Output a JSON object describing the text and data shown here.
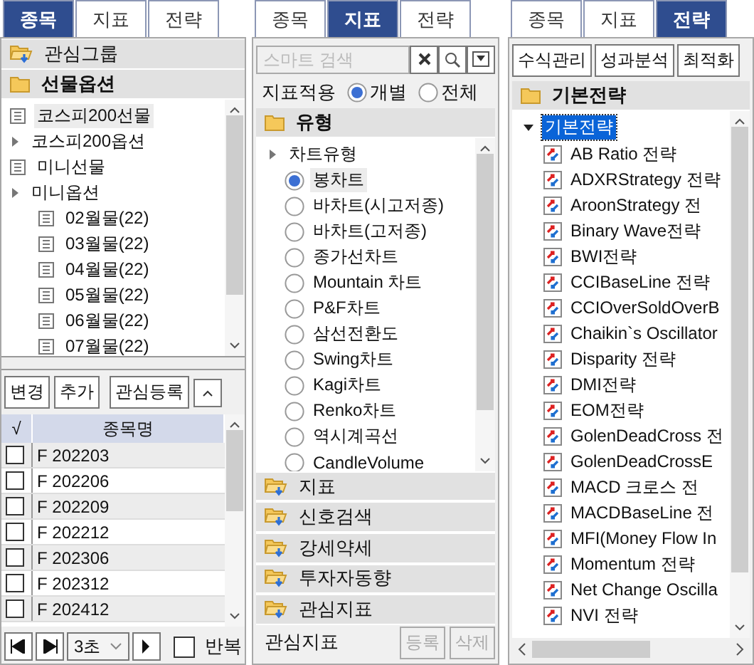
{
  "stock_panel": {
    "tabs": [
      {
        "label": "종목",
        "selected": true
      },
      {
        "label": "지표",
        "selected": false
      },
      {
        "label": "전략",
        "selected": false
      }
    ],
    "groups": [
      {
        "label": "관심그룹",
        "kind": "download"
      },
      {
        "label": "선물옵션",
        "kind": "folder"
      }
    ],
    "tree": [
      {
        "label": "코스피200선물",
        "kind": "leaf",
        "selected": true
      },
      {
        "label": "코스피200옵션",
        "kind": "branch",
        "selected": false
      },
      {
        "label": "미니선물",
        "kind": "leaf",
        "selected": false
      },
      {
        "label": "미니옵션",
        "kind": "branch",
        "selected": false,
        "children": [
          {
            "label": "02월물(22)",
            "kind": "leaf",
            "selected": false
          },
          {
            "label": "03월물(22)",
            "kind": "leaf",
            "selected": false
          },
          {
            "label": "04월물(22)",
            "kind": "leaf",
            "selected": false
          },
          {
            "label": "05월물(22)",
            "kind": "leaf",
            "selected": false
          },
          {
            "label": "06월물(22)",
            "kind": "leaf",
            "selected": false
          },
          {
            "label": "07월물(22)",
            "kind": "leaf",
            "selected": false
          }
        ]
      }
    ],
    "buttons": [
      "변경",
      "추가",
      "관심등록"
    ],
    "columns": [
      "√",
      "종목명"
    ],
    "rows": [
      {
        "name": "F 202203",
        "checked": false
      },
      {
        "name": "F 202206",
        "checked": false
      },
      {
        "name": "F 202209",
        "checked": false
      },
      {
        "name": "F 202212",
        "checked": false
      },
      {
        "name": "F 202306",
        "checked": false
      },
      {
        "name": "F 202312",
        "checked": false
      },
      {
        "name": "F 202412",
        "checked": false
      }
    ],
    "interval": "3초",
    "repeat": {
      "label": "반복",
      "checked": false
    }
  },
  "indicator_panel": {
    "tabs": [
      {
        "label": "종목",
        "selected": false
      },
      {
        "label": "지표",
        "selected": true
      },
      {
        "label": "전략",
        "selected": false
      }
    ],
    "search": {
      "placeholder": "스마트 검색"
    },
    "apply_label": "지표적용",
    "apply_options": [
      {
        "label": "개별",
        "selected": true
      },
      {
        "label": "전체",
        "selected": false
      }
    ],
    "section": "유형",
    "tree": {
      "label": "차트유형",
      "items": [
        {
          "label": "봉차트",
          "selected": true
        },
        {
          "label": "바차트(시고저종)",
          "selected": false
        },
        {
          "label": "바차트(고저종)",
          "selected": false
        },
        {
          "label": "종가선차트",
          "selected": false
        },
        {
          "label": "Mountain 차트",
          "selected": false
        },
        {
          "label": "P&F차트",
          "selected": false
        },
        {
          "label": "삼선전환도",
          "selected": false
        },
        {
          "label": "Swing차트",
          "selected": false
        },
        {
          "label": "Kagi차트",
          "selected": false
        },
        {
          "label": "Renko차트",
          "selected": false
        },
        {
          "label": "역시계곡선",
          "selected": false
        },
        {
          "label": "CandleVolume",
          "selected": false
        }
      ]
    },
    "folders": [
      "지표",
      "신호검색",
      "강세약세",
      "투자자동향",
      "관심지표"
    ],
    "footer_label": "관심지표",
    "footer_buttons": [
      {
        "label": "등록",
        "disabled": true
      },
      {
        "label": "삭제",
        "disabled": true
      }
    ]
  },
  "strategy_panel": {
    "tabs": [
      {
        "label": "종목",
        "selected": false
      },
      {
        "label": "지표",
        "selected": false
      },
      {
        "label": "전략",
        "selected": true
      }
    ],
    "buttons": [
      "수식관리",
      "성과분석",
      "최적화"
    ],
    "section": "기본전략",
    "tree": {
      "label": "기본전략",
      "expanded": true,
      "selected": true,
      "items": [
        "AB Ratio 전략",
        "ADXRStrategy 전략",
        "AroonStrategy 전",
        "Binary Wave전략",
        "BWI전략",
        "CCIBaseLine 전략",
        "CCIOverSoldOverB",
        "Chaikin`s Oscillator",
        "Disparity 전략",
        "DMI전략",
        "EOM전략",
        "GolenDeadCross 전",
        "GolenDeadCrossE",
        "MACD 크로스 전",
        "MACDBaseLine 전",
        "MFI(Money Flow In",
        "Momentum 전략",
        "Net Change Oscilla",
        "NVI 전략"
      ]
    }
  }
}
